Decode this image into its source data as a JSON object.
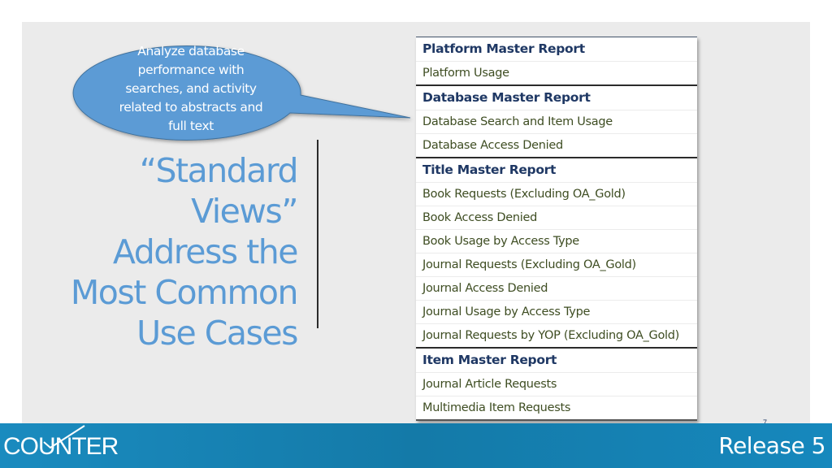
{
  "callout": {
    "text": "Analyze database performance with searches, and activity related to abstracts and full text",
    "fill_color": "#5b9bd5"
  },
  "title": {
    "lines": [
      "“Standard Views”",
      "Address the",
      "Most Common",
      "Use Cases"
    ],
    "color": "#5b9bd5"
  },
  "report_groups": [
    {
      "header": "Platform Master Report",
      "items": [
        "Platform Usage"
      ]
    },
    {
      "header": "Database Master Report",
      "items": [
        "Database Search and Item Usage",
        "Database Access Denied"
      ]
    },
    {
      "header": "Title Master Report",
      "items": [
        "Book Requests (Excluding OA_Gold)",
        "Book Access Denied",
        "Book Usage by Access Type",
        "Journal Requests (Excluding OA_Gold)",
        "Journal Access Denied",
        "Journal Usage by Access Type",
        "Journal Requests by YOP (Excluding OA_Gold)"
      ]
    },
    {
      "header": "Item Master Report",
      "items": [
        "Journal Article Requests",
        "Multimedia Item Requests"
      ]
    }
  ],
  "footer": {
    "logo_text": "COUNTER",
    "release_label": "Release 5",
    "page_number": "7",
    "bar_color": "#1785b8"
  }
}
